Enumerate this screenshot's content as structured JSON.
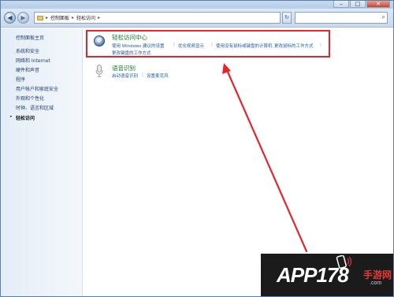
{
  "window": {
    "controls": {
      "minimize": "–",
      "maximize": "□",
      "close": "✕"
    }
  },
  "address_bar": {
    "segments": [
      "控制面板",
      "轻松访问"
    ],
    "separator": "▸",
    "dropdown": "▾",
    "refresh_glyph": "↻",
    "search_placeholder": ""
  },
  "sidebar": {
    "home": "控制面板主页",
    "items": [
      "系统和安全",
      "网络和 Internet",
      "硬件和声音",
      "程序",
      "用户帐户和家庭安全",
      "外观和个性化",
      "时钟、语言和区域",
      "轻松访问"
    ],
    "current_index": 7,
    "bullet": "•"
  },
  "categories": {
    "ease_center": {
      "title": "轻松访问中心",
      "links": [
        "使用 Windows 建议的设置",
        "优化视频显示",
        "使用没有鼠标或键盘的计算机",
        "更改鼠标的工作方式",
        "更改键盘的工作方式"
      ],
      "icon": "ease-of-access-icon"
    },
    "speech": {
      "title": "语音识别",
      "links": [
        "启动语音识别",
        "设置麦克风"
      ],
      "icon": "microphone-icon"
    }
  },
  "annotation": {
    "highlight_color": "#e2262b",
    "arrow_color": "#e2262b"
  },
  "watermark": {
    "brand": "APP178",
    "sub": "手游网",
    "domain": ".com"
  }
}
